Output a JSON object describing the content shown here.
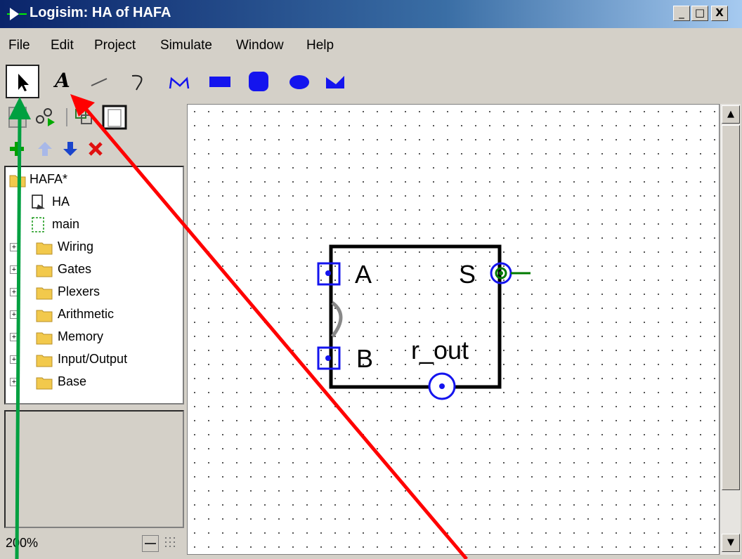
{
  "window": {
    "title": "Logisim: HA of HAFA"
  },
  "titlebar_buttons": {
    "minimize": "_",
    "maximize": "□",
    "close": "X"
  },
  "menu": [
    "File",
    "Edit",
    "Project",
    "Simulate",
    "Window",
    "Help"
  ],
  "toolbar": {
    "tools": [
      "select-tool",
      "text-tool",
      "line-tool",
      "curve-tool",
      "polyline-tool",
      "rectangle-tool",
      "rounded-rect-tool",
      "oval-tool",
      "polygon-tool"
    ],
    "text_tool_glyph": "A"
  },
  "explorer": {
    "project": "HAFA*",
    "circuits": [
      "HA",
      "main"
    ],
    "libraries": [
      "Wiring",
      "Gates",
      "Plexers",
      "Arithmetic",
      "Memory",
      "Input/Output",
      "Base"
    ]
  },
  "zoom": "200%",
  "circuit": {
    "inputs": [
      "A",
      "B"
    ],
    "outputs": [
      "S",
      "r_out"
    ]
  },
  "colors": {
    "accent_blue": "#1414ee",
    "wire_green": "#007a00",
    "annotation_red": "#ff0000",
    "annotation_green": "#00a040"
  }
}
